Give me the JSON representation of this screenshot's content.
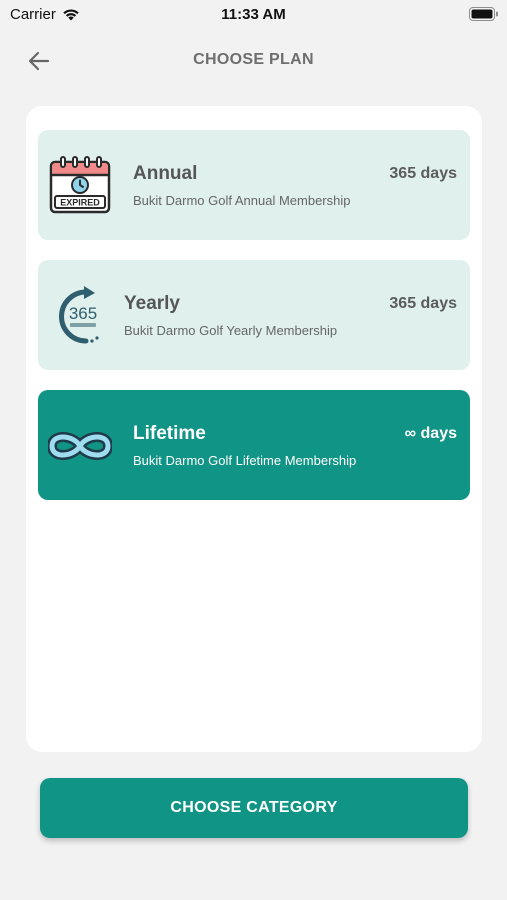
{
  "status_bar": {
    "carrier": "Carrier",
    "time": "11:33 AM"
  },
  "header": {
    "title": "CHOOSE PLAN"
  },
  "plans": [
    {
      "name": "Annual",
      "description": "Bukit Darmo Golf Annual Membership",
      "duration": "365 days",
      "icon": "expired-calendar-icon",
      "icon_text": "EXPIRED",
      "selected": false
    },
    {
      "name": "Yearly",
      "description": "Bukit Darmo Golf Yearly Membership",
      "duration": "365 days",
      "icon": "365-days-icon",
      "icon_text": "365",
      "selected": false
    },
    {
      "name": "Lifetime",
      "description": "Bukit Darmo Golf Lifetime Membership",
      "duration": "∞ days",
      "icon": "infinity-icon",
      "selected": true
    }
  ],
  "footer": {
    "button_label": "CHOOSE CATEGORY"
  },
  "colors": {
    "accent": "#109486",
    "card_bg": "#e0f0ed",
    "page_bg": "#f2f2f2"
  }
}
